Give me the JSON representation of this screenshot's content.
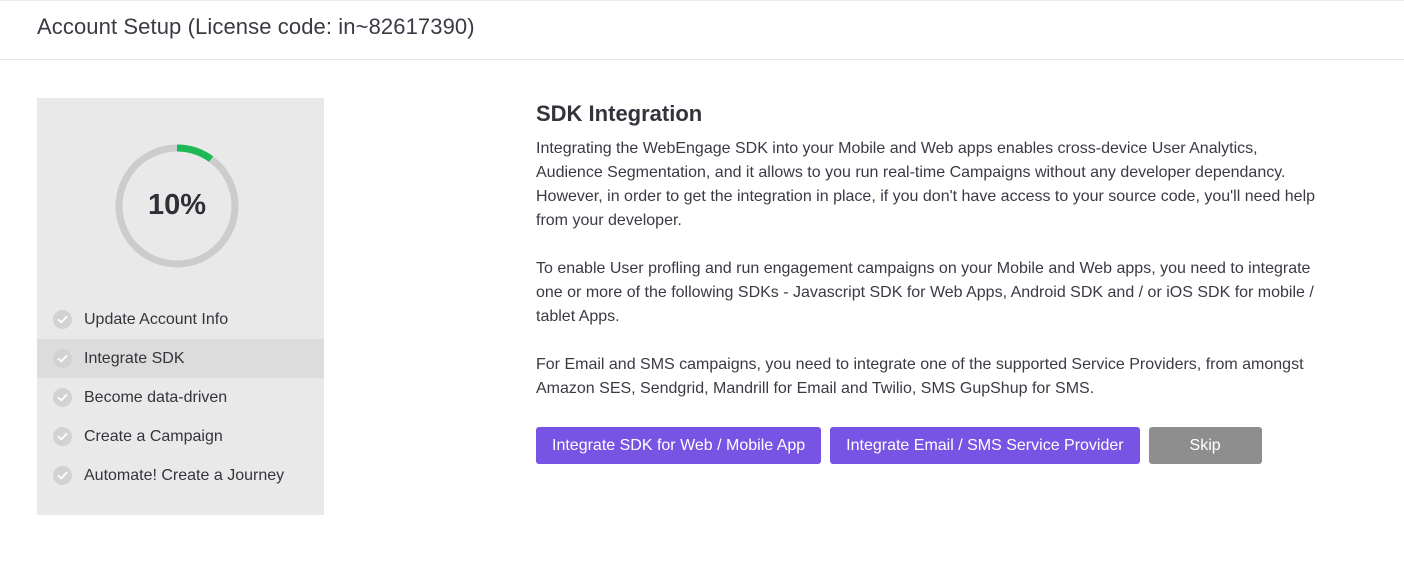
{
  "header": {
    "title": "Account Setup (License code: in~82617390)"
  },
  "sidebar": {
    "progress": {
      "percent": 10,
      "label": "10%",
      "track_color": "#cccccc",
      "fill_color": "#1db954"
    },
    "steps": [
      {
        "label": "Update Account Info",
        "icon": "check-circle-icon",
        "active": false
      },
      {
        "label": "Integrate SDK",
        "icon": "check-circle-icon",
        "active": true
      },
      {
        "label": "Become data-driven",
        "icon": "check-circle-icon",
        "active": false
      },
      {
        "label": "Create a Campaign",
        "icon": "check-circle-icon",
        "active": false
      },
      {
        "label": "Automate! Create a Journey",
        "icon": "check-circle-icon",
        "active": false
      }
    ]
  },
  "main": {
    "title": "SDK Integration",
    "paragraphs": [
      "Integrating the WebEngage SDK into your Mobile and Web apps enables cross-device User Analytics, Audience Segmentation, and it allows to you run real-time Campaigns without any developer dependancy. However, in order to get the integration in place, if you don't have access to your source code, you'll need help from your developer.",
      "To enable User profling and run engagement campaigns on your Mobile and Web apps, you need to integrate one or more of the following SDKs - Javascript SDK for Web Apps, Android SDK and / or iOS SDK for mobile / tablet Apps.",
      "For Email and SMS campaigns, you need to integrate one of the supported Service Providers, from amongst Amazon SES, Sendgrid, Mandrill for Email and Twilio, SMS GupShup for SMS."
    ],
    "buttons": {
      "integrate_sdk": "Integrate SDK for Web / Mobile App",
      "integrate_email": "Integrate Email / SMS Service Provider",
      "skip": "Skip"
    }
  },
  "colors": {
    "primary_button": "#7754e4",
    "skip_button": "#8e8e8e",
    "sidebar_bg": "#e9e9e9",
    "active_step_bg": "#dcdcdc"
  }
}
